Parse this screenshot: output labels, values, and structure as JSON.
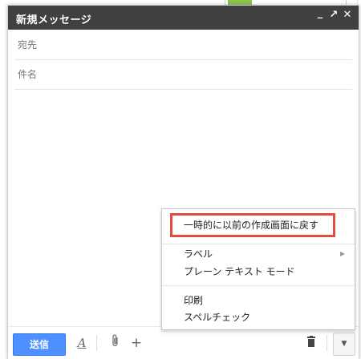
{
  "compose": {
    "title": "新規メッセージ",
    "minimize": "_",
    "popout": "↗",
    "close": "✕",
    "to_label": "宛先",
    "subject_label": "件名"
  },
  "toolbar": {
    "send_label": "送信",
    "format_icon": "text-format-icon",
    "attach_icon": "paperclip-icon",
    "insert_icon": "plus-icon",
    "trash_icon": "trash-icon",
    "more_icon": "chevron-down-icon"
  },
  "menu": {
    "items": [
      {
        "label": "一時的に以前の作成画面に戻す"
      },
      {
        "label": "ラベル"
      },
      {
        "label": "プレーン テキスト モード"
      },
      {
        "label": "印刷"
      },
      {
        "label": "スペルチェック"
      }
    ],
    "submenu_arrow": "▶"
  },
  "colors": {
    "titlebar": "#404040",
    "send_button": "#4d90fe",
    "highlight": "#e04c3f"
  }
}
